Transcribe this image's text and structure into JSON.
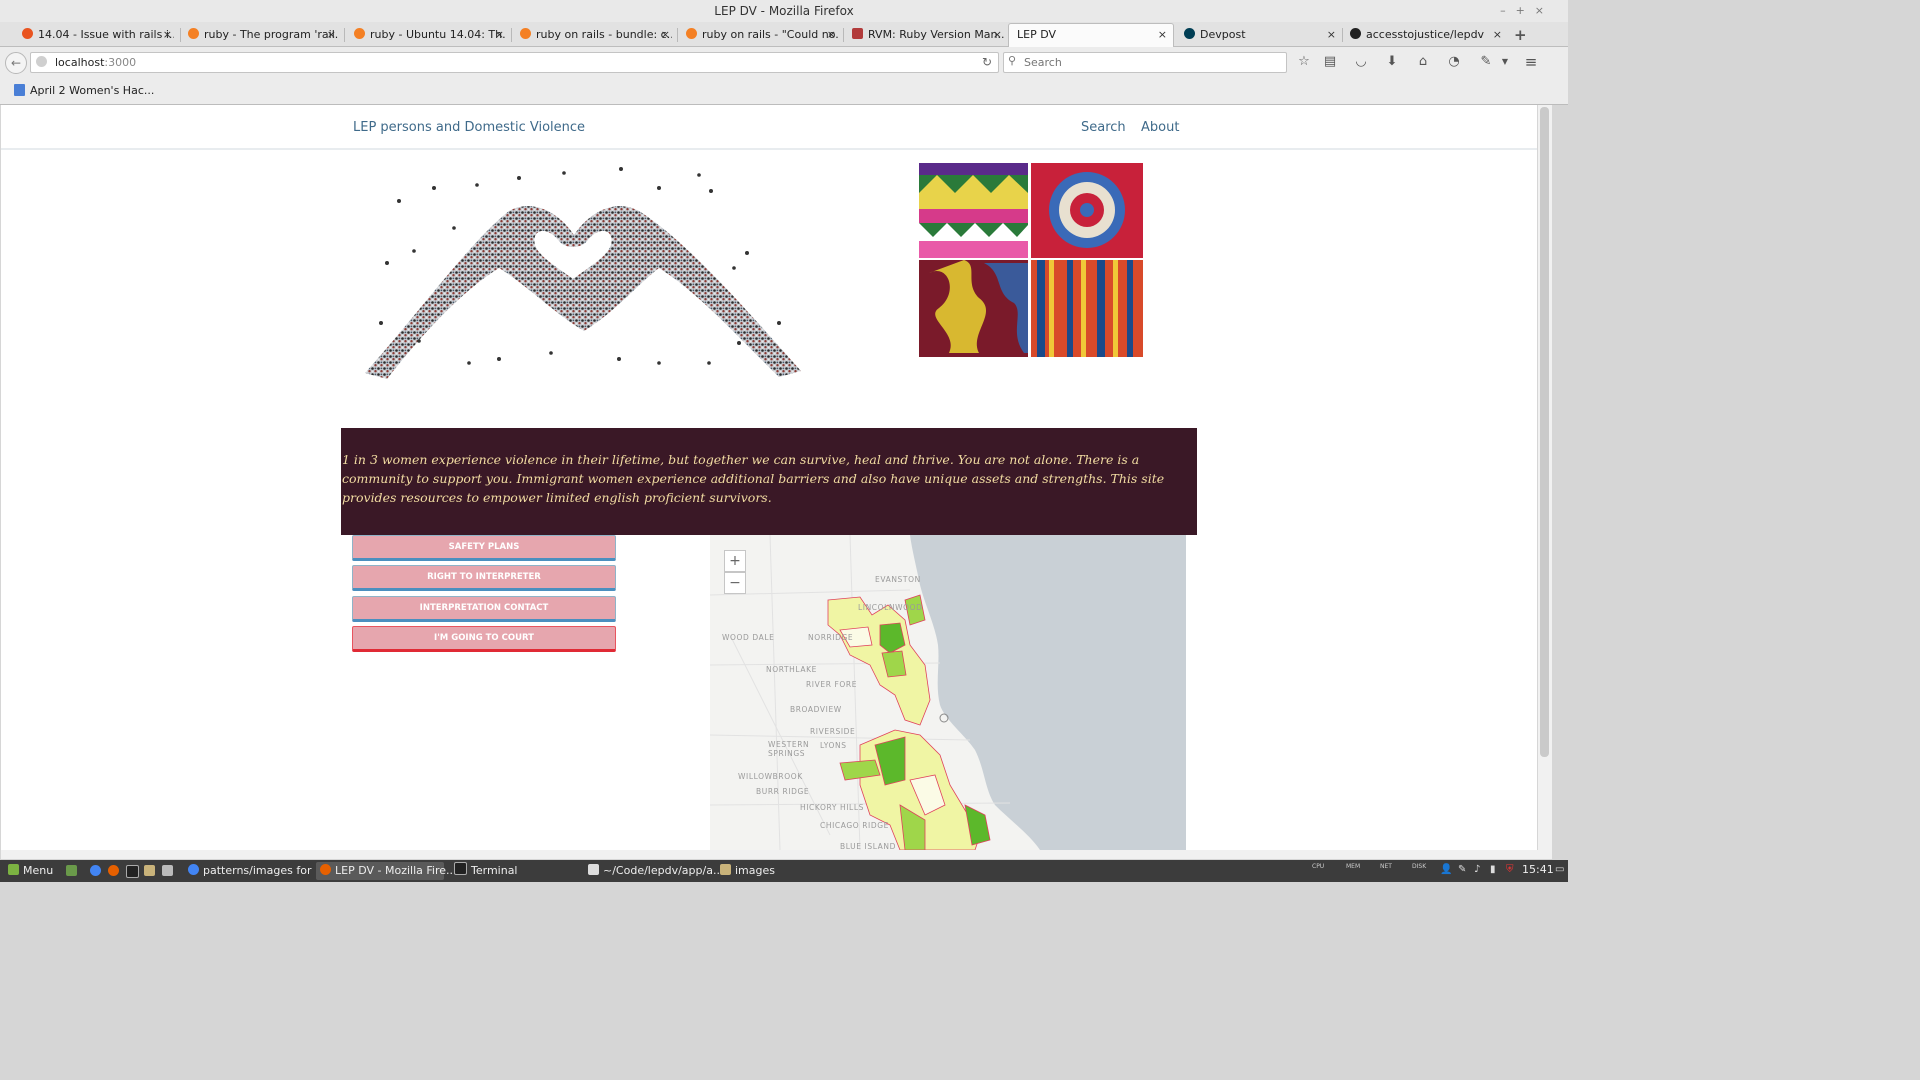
{
  "window": {
    "title": "LEP DV - Mozilla Firefox",
    "controls": "–+×"
  },
  "tabs": [
    {
      "label": "14.04 - Issue with rails i...",
      "icon": "askubuntu-icon",
      "color": "#e95420"
    },
    {
      "label": "ruby - The program 'rail...",
      "icon": "stackoverflow-icon",
      "color": "#f48024"
    },
    {
      "label": "ruby - Ubuntu 14.04: Th...",
      "icon": "stackoverflow-icon",
      "color": "#f48024"
    },
    {
      "label": "ruby on rails - bundle: c...",
      "icon": "stackoverflow-icon",
      "color": "#f48024"
    },
    {
      "label": "ruby on rails - \"Could no...",
      "icon": "stackoverflow-icon",
      "color": "#f48024"
    },
    {
      "label": "RVM: Ruby Version Man...",
      "icon": "rvm-icon",
      "color": "#b23b3b"
    },
    {
      "label": "LEP DV",
      "icon": "",
      "color": ""
    },
    {
      "label": "Devpost",
      "icon": "devpost-icon",
      "color": "#003e54"
    },
    {
      "label": "accesstojustice/lepdv",
      "icon": "github-icon",
      "color": "#222222"
    }
  ],
  "tab_close": "×",
  "new_tab": "+",
  "nav": {
    "back": "←",
    "url_host": "localhost",
    "url_port": ":3000",
    "reload": "↻",
    "search_placeholder": "Search",
    "menu": "≡"
  },
  "bookmarks": [
    {
      "label": "April 2 Women's Hac..."
    }
  ],
  "site": {
    "brand": "LEP persons and Domestic Violence",
    "nav_search": "Search",
    "nav_about": "About",
    "banner_text": "1 in 3 women experience violence in their lifetime, but together we can survive, heal and thrive. You are not alone. There is a community to support you. Immigrant women experience additional barriers and also have unique assets and strengths. This site provides resources to empower limited english proficient survivors.",
    "buttons": [
      "SAFETY PLANS",
      "RIGHT TO INTERPRETER",
      "INTERPRETATION CONTACT",
      "I'M GOING TO COURT"
    ],
    "map": {
      "zoom_in": "+",
      "zoom_out": "−",
      "labels": [
        "EVANSTON",
        "WOOD DALE",
        "NORTHLAKE",
        "RIVER FORE",
        "BROADVIEW",
        "RIVERSIDE",
        "WESTERN SPRINGS",
        "LYONS",
        "WILLOWBROOK",
        "BURR RIDGE",
        "HICKORY HILLS",
        "CHICAGO RIDGE",
        "BLUE ISLAND",
        "LINCOLNWOOD",
        "NORRIDGE"
      ],
      "fill_light": "#f0f5a4",
      "fill_mid": "#9fd64a",
      "fill_dark": "#5cb82b",
      "border": "#e0415c"
    }
  },
  "taskbar": {
    "menu": "Menu",
    "items": [
      "patterns/images for ...",
      "LEP DV - Mozilla Fire...",
      "Terminal",
      "~/Code/lepdv/app/a...",
      "images"
    ],
    "tray": [
      "CPU",
      "MEM",
      "NET",
      "DISK"
    ],
    "clock": "15:41"
  }
}
